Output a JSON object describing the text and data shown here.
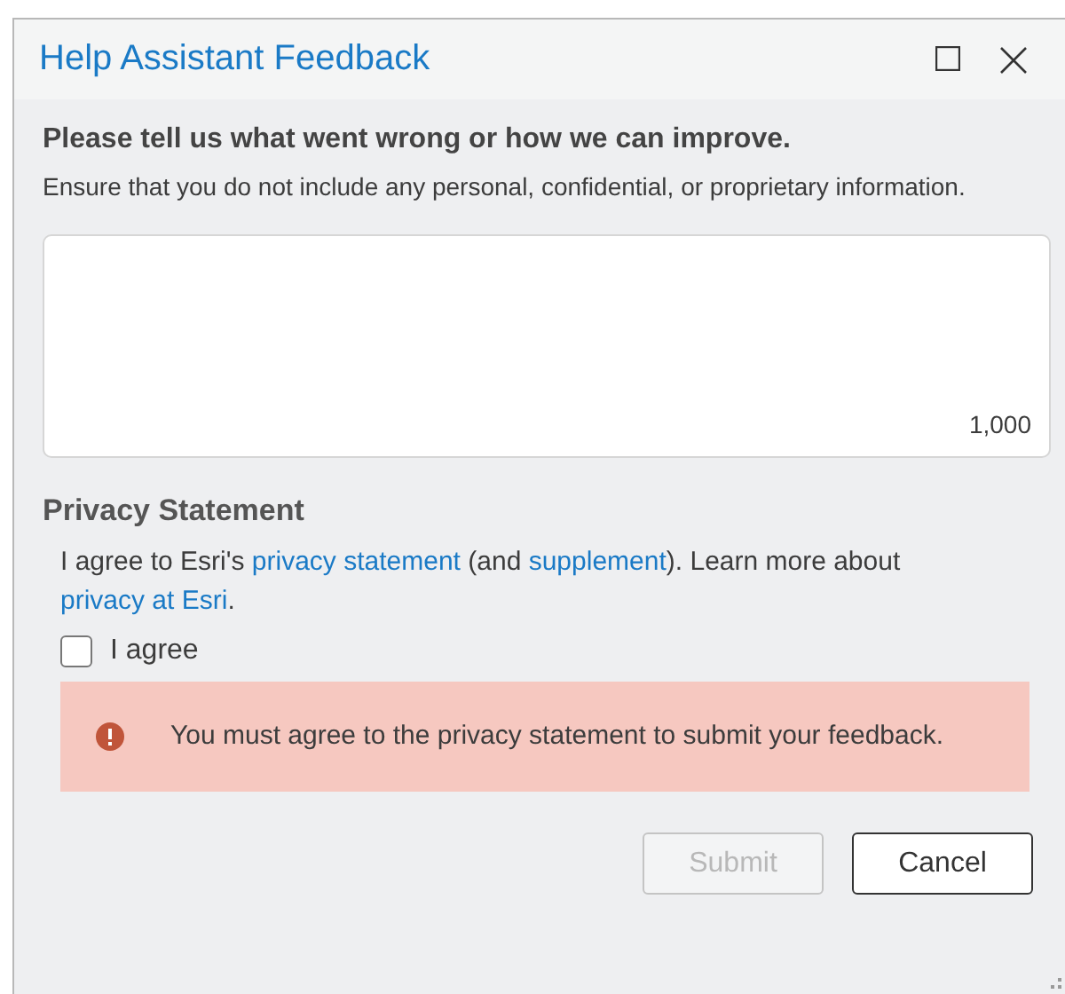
{
  "window": {
    "title": "Help Assistant Feedback"
  },
  "prompt": {
    "heading": "Please tell us what went wrong or how we can improve.",
    "note": "Ensure that you do not include any personal, confidential, or proprietary information."
  },
  "feedback_field": {
    "counter": "1,000"
  },
  "privacy": {
    "heading": "Privacy Statement",
    "parts": [
      {
        "kind": "text",
        "text": "I agree to Esri's "
      },
      {
        "kind": "link",
        "text": "privacy statement"
      },
      {
        "kind": "text",
        "text": " (and "
      },
      {
        "kind": "link",
        "text": "supplement"
      },
      {
        "kind": "text",
        "text": "). Learn more about "
      },
      {
        "kind": "link",
        "text": "privacy at Esri"
      },
      {
        "kind": "text",
        "text": "."
      }
    ],
    "agree": {
      "label": "I agree",
      "checked": false
    }
  },
  "error": {
    "message": "You must agree to the privacy statement to submit your feedback."
  },
  "buttons": [
    {
      "label": "Submit",
      "disabled": true
    },
    {
      "label": "Cancel",
      "disabled": false
    }
  ]
}
